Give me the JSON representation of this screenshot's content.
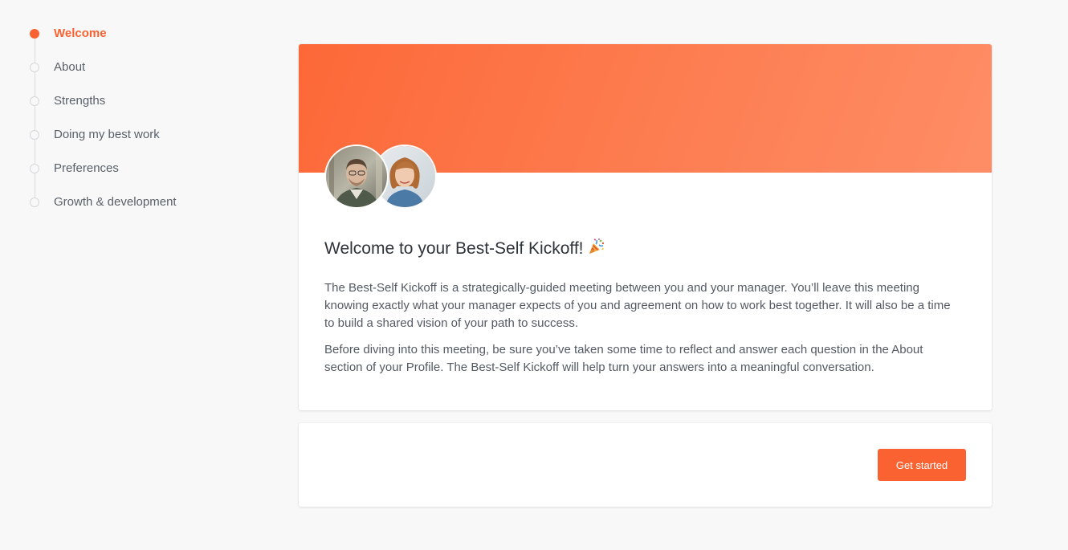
{
  "steps": [
    {
      "label": "Welcome",
      "active": true
    },
    {
      "label": "About",
      "active": false
    },
    {
      "label": "Strengths",
      "active": false
    },
    {
      "label": "Doing my best work",
      "active": false
    },
    {
      "label": "Preferences",
      "active": false
    },
    {
      "label": "Growth & development",
      "active": false
    }
  ],
  "welcome": {
    "title": "Welcome to your Best-Self Kickoff!",
    "title_icon": "party-popper-icon",
    "paragraphs": [
      "The Best-Self Kickoff is a strategically-guided meeting between you and your manager. You’ll leave this meeting knowing exactly what your manager expects of you and agreement on how to work best together. It will also be a time to build a shared vision of your path to success.",
      "Before diving into this meeting, be sure you’ve taken some time to reflect and answer each question in the About section of your Profile. The Best-Self Kickoff will help turn your answers into a meaningful conversation."
    ]
  },
  "footer": {
    "cta_label": "Get started"
  },
  "colors": {
    "accent": "#fa6232",
    "banner_start": "#fd6838",
    "banner_end": "#fe8d66",
    "background": "#f8f8f8"
  }
}
